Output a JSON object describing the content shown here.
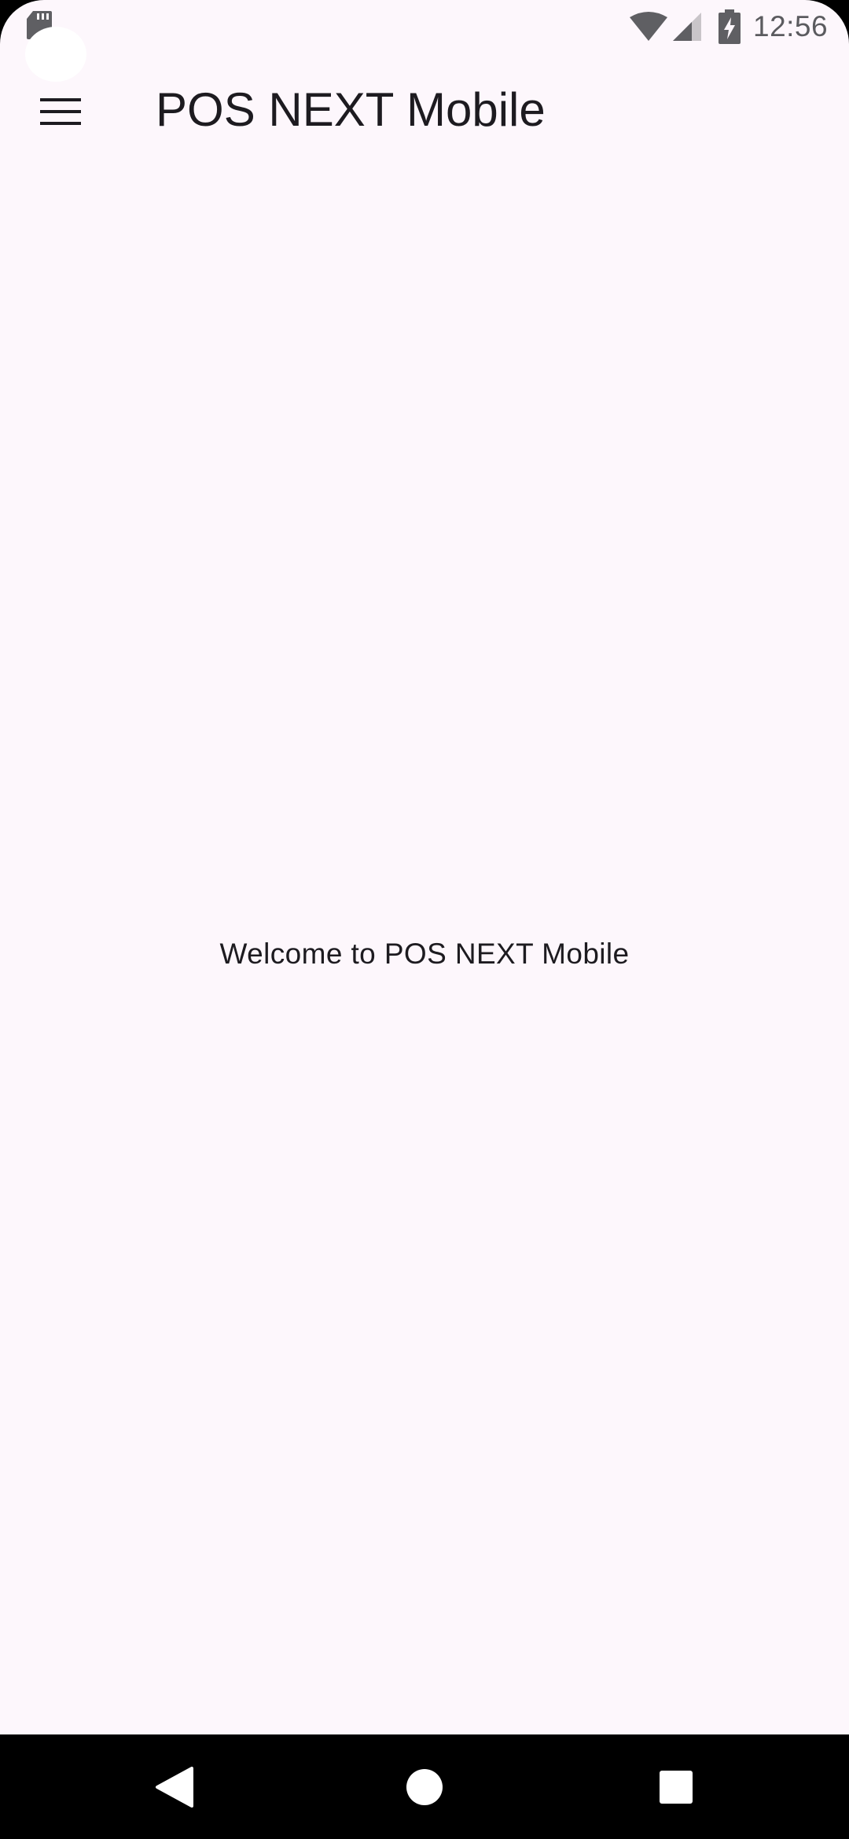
{
  "status_bar": {
    "time": "12:56",
    "icons": [
      "sd-card-icon",
      "wifi-icon",
      "cell-signal-icon",
      "battery-charging-icon"
    ]
  },
  "app_bar": {
    "menu_icon": "hamburger-menu-icon",
    "title": "POS NEXT Mobile"
  },
  "main": {
    "welcome_text": "Welcome to POS NEXT Mobile"
  },
  "nav_bar": {
    "buttons": [
      "back-icon",
      "home-icon",
      "recents-icon"
    ]
  },
  "colors": {
    "background": "#FDF7FC",
    "text": "#1D1B20",
    "status_icons": "#5F5F63",
    "nav_bar": "#000000"
  }
}
